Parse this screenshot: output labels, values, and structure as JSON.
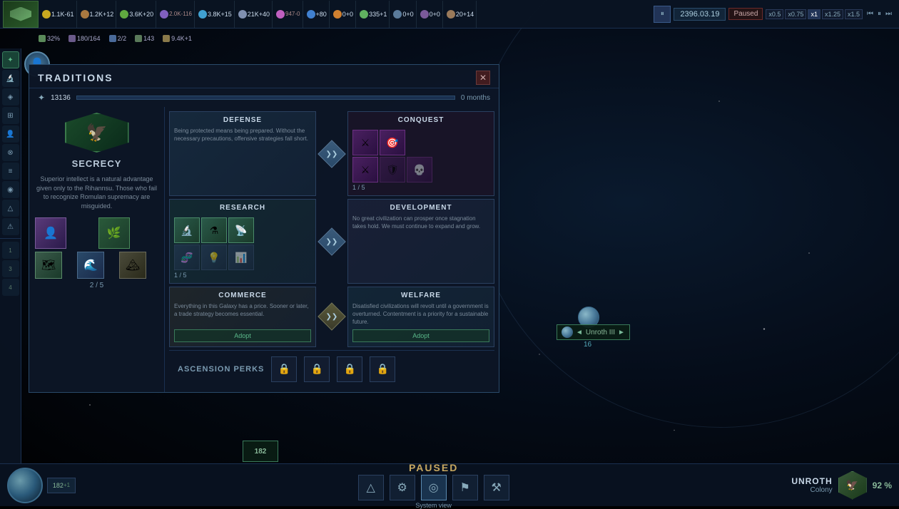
{
  "meta": {
    "title": "Stellaris - Traditions"
  },
  "topbar": {
    "resources": [
      {
        "id": "credits",
        "icon": "ic-credits",
        "value": "1.1K-61",
        "delta": "",
        "symbol": "★"
      },
      {
        "id": "minerals",
        "icon": "ic-minerals",
        "value": "1.2K+12",
        "delta": "",
        "symbol": "◆"
      },
      {
        "id": "food",
        "icon": "ic-food",
        "value": "3.6K+20",
        "delta": "",
        "symbol": "🌿"
      },
      {
        "id": "pop",
        "icon": "ic-pop",
        "value": "2.0K-116",
        "delta": "",
        "symbol": "👤"
      },
      {
        "id": "energy",
        "icon": "ic-energy",
        "value": "3.8K+15",
        "delta": "",
        "symbol": "⚡"
      },
      {
        "id": "alloys",
        "icon": "ic-alloys",
        "value": "21K+40",
        "delta": "",
        "symbol": "⚙"
      },
      {
        "id": "unity",
        "icon": "ic-unity",
        "value": "947-0",
        "delta": "",
        "symbol": "✦"
      },
      {
        "id": "science",
        "icon": "ic-science",
        "value": "+80",
        "delta": "",
        "symbol": "🔬"
      },
      {
        "id": "influence",
        "icon": "ic-influence",
        "value": "0+0",
        "delta": "",
        "symbol": "◉"
      },
      {
        "id": "consumer",
        "icon": "ic-consumer",
        "value": "335+1",
        "delta": "",
        "symbol": "☯"
      },
      {
        "id": "r1",
        "icon": "ic-credits",
        "value": "0+0",
        "delta": "",
        "symbol": ""
      },
      {
        "id": "r2",
        "icon": "ic-credits",
        "value": "0+0",
        "delta": "",
        "symbol": ""
      },
      {
        "id": "r3",
        "icon": "ic-credits",
        "value": "20+14",
        "delta": "",
        "symbol": ""
      }
    ],
    "date": "2396.03.19",
    "status": "Paused",
    "speeds": [
      "x0.5",
      "x0.75",
      "x1",
      "x1.25",
      "x1.5"
    ]
  },
  "secondbar": {
    "items": [
      {
        "label": "32%"
      },
      {
        "label": "180/164"
      },
      {
        "label": "2/2"
      },
      {
        "label": "143"
      },
      {
        "label": "9.4K+1"
      }
    ]
  },
  "traditions_panel": {
    "title": "TRADITIONS",
    "close_label": "✕",
    "unity_value": "13136",
    "time_label": "0 months",
    "secrecy": {
      "title": "SECRECY",
      "description": "Superior intellect is a natural advantage given only to the Rihannsu. Those who fail to recognize Romulan supremacy are misguided.",
      "traits": [
        {
          "emoji": "👤",
          "color": "#8060a0"
        },
        {
          "emoji": "🌿",
          "color": "#40a040"
        },
        {
          "emoji": "🗺",
          "color": "#508060"
        },
        {
          "emoji": "🌊",
          "color": "#4080a0"
        },
        {
          "emoji": "🏔",
          "color": "#707060"
        }
      ],
      "progress": "2 / 5"
    },
    "cards": [
      {
        "id": "defense",
        "title": "DEFENSE",
        "description": "Being protected means being prepared. Without the necessary precautions, offensive strategies fall short.",
        "images": [],
        "progress": null,
        "adopt": null,
        "completed": false
      },
      {
        "id": "conquest",
        "title": "CONQUEST",
        "description": "",
        "images": [
          {
            "emoji": "⚔",
            "active": true
          },
          {
            "emoji": "🎯",
            "active": true
          },
          {
            "emoji": "🛡",
            "active": false
          },
          {
            "emoji": "💀",
            "active": false
          },
          {
            "emoji": "🔱",
            "active": false
          }
        ],
        "progress": "1 / 5",
        "adopt": null,
        "completed": false
      },
      {
        "id": "research",
        "title": "RESEARCH",
        "description": "",
        "images": [
          {
            "emoji": "🔬",
            "active": true
          },
          {
            "emoji": "⚗",
            "active": true
          },
          {
            "emoji": "📡",
            "active": true
          },
          {
            "emoji": "🧬",
            "active": false
          },
          {
            "emoji": "💡",
            "active": false
          }
        ],
        "progress": "1 / 5",
        "adopt": null,
        "completed": false
      },
      {
        "id": "development",
        "title": "DEVELOPMENT",
        "description": "No great civilization can prosper once stagnation takes hold. We must continue to expand and grow.",
        "images": [],
        "progress": null,
        "adopt": null,
        "completed": false
      },
      {
        "id": "commerce",
        "title": "COMMERCE",
        "description": "Everything in this Galaxy has a price. Sooner or later, a trade strategy becomes essential.",
        "images": [],
        "progress": null,
        "adopt": "Adopt",
        "completed": false
      },
      {
        "id": "welfare",
        "title": "WELFARE",
        "description": "Disatisfied civilizations will revolt until a government is overturned. Contentment is a priority for a sustainable future.",
        "images": [],
        "progress": null,
        "adopt": "Adopt",
        "completed": false
      }
    ],
    "ascension_perks": {
      "label": "ASCENSION PERKS",
      "perks": [
        {
          "emoji": "🔒"
        },
        {
          "emoji": "🔒"
        },
        {
          "emoji": "🔒"
        },
        {
          "emoji": "🔒"
        }
      ]
    }
  },
  "planet": {
    "name": "Unroth III",
    "number": "16",
    "arrows": "◄ ►"
  },
  "bottombar": {
    "paused_label": "PAUSED",
    "system_view_label": "System view",
    "bottom_actions": [
      {
        "id": "arrows-up",
        "emoji": "△"
      },
      {
        "id": "gear",
        "emoji": "⚙"
      },
      {
        "id": "planet",
        "emoji": "◎"
      },
      {
        "id": "flag",
        "emoji": "⚑"
      },
      {
        "id": "tools",
        "emoji": "⚒"
      }
    ],
    "faction": {
      "name": "UNROTH",
      "type": "Colony",
      "stability": "92 %"
    },
    "population": "182",
    "pop_delta": "+1"
  },
  "sidebar": {
    "items": [
      {
        "id": "traditions",
        "emoji": "✦",
        "active": true
      },
      {
        "id": "tech",
        "emoji": "🔬"
      },
      {
        "id": "empire",
        "emoji": "◈"
      },
      {
        "id": "sectors",
        "emoji": "◫"
      },
      {
        "id": "species",
        "emoji": "👤"
      },
      {
        "id": "ethics",
        "emoji": "⊗"
      },
      {
        "id": "policies",
        "emoji": "📋"
      },
      {
        "id": "contacts",
        "emoji": "📡"
      },
      {
        "id": "ships",
        "emoji": "🚀"
      },
      {
        "id": "situations",
        "emoji": "⚠"
      },
      {
        "id": "outliner",
        "emoji": "≡"
      }
    ]
  },
  "icons": {
    "unity_symbol": "✦",
    "lock_symbol": "🔒",
    "arrow_right": "▶",
    "arrow_left": "◀",
    "chevron": "❯❯"
  }
}
